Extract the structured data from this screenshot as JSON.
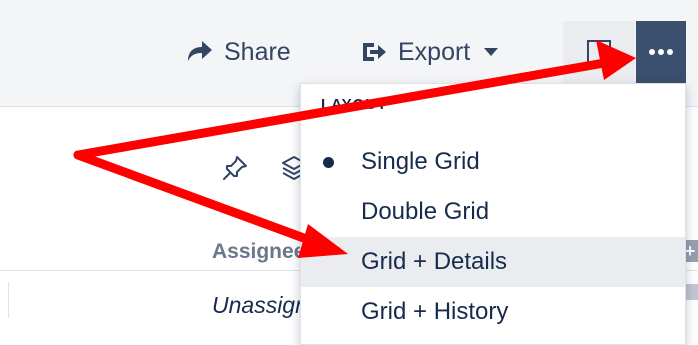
{
  "toolbar": {
    "share_label": "Share",
    "export_label": "Export"
  },
  "icons": {
    "share": "share-icon",
    "export": "export-icon",
    "caret": "chevron-down-icon",
    "square": "square-icon",
    "more": "ellipsis-icon",
    "pin": "pin-icon",
    "layers": "layers-icon"
  },
  "table": {
    "column_header": "Assignee",
    "cell_value": "Unassigned"
  },
  "dropdown": {
    "header": "LAYOUT",
    "items": [
      {
        "label": "Single Grid",
        "selected": true
      },
      {
        "label": "Double Grid",
        "selected": false
      },
      {
        "label": "Grid + Details",
        "selected": false
      },
      {
        "label": "Grid + History",
        "selected": false
      }
    ]
  },
  "colors": {
    "toolbar_bg": "#f4f5f7",
    "more_button_bg": "#3b4f6e",
    "hover_bg": "#ebecf0",
    "text": "#172b4d",
    "arrow": "#ff0000"
  }
}
